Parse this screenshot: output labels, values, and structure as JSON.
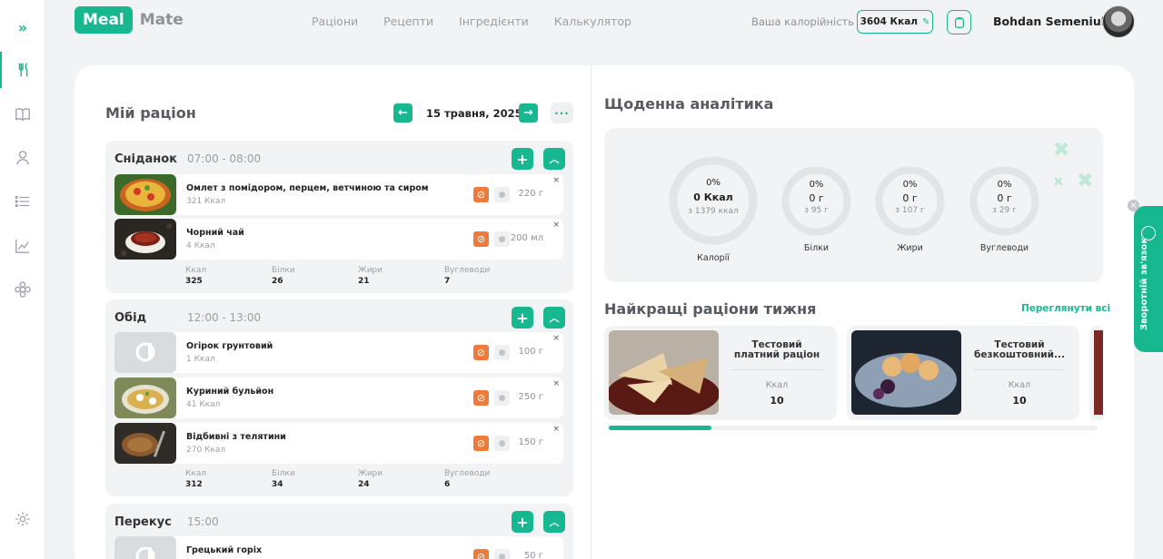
{
  "logo": {
    "part1": "Meal",
    "part2": "Mate"
  },
  "nav": [
    "Раціони",
    "Рецепти",
    "Інгредієнти",
    "Калькулятор"
  ],
  "calories": {
    "label": "Ваша калорійність",
    "value": "3604 Ккал"
  },
  "user": {
    "name": "Bohdan Semeniuk"
  },
  "diet": {
    "title": "Мій раціон",
    "date": "15 травня, 2025",
    "meals": [
      {
        "name": "Сніданок",
        "time": "07:00 - 08:00",
        "items": [
          {
            "name": "Омлет з помідором, перцем, ветчиною та сиром",
            "kcal": "321 Ккал",
            "qty": "220 г"
          },
          {
            "name": "Чорний чай",
            "kcal": "4 Ккал",
            "qty": "200 мл"
          }
        ],
        "totals": {
          "kcal": "325",
          "protein": "26",
          "fat": "21",
          "carbs": "7"
        }
      },
      {
        "name": "Обід",
        "time": "12:00 - 13:00",
        "items": [
          {
            "name": "Огірок грунтовий",
            "kcal": "1 Ккал",
            "qty": "100 г"
          },
          {
            "name": "Куриний бульйон",
            "kcal": "41 Ккал",
            "qty": "250 г"
          },
          {
            "name": "Відбивні з телятини",
            "kcal": "270 Ккал",
            "qty": "150 г"
          }
        ],
        "totals": {
          "kcal": "312",
          "protein": "34",
          "fat": "24",
          "carbs": "6"
        }
      },
      {
        "name": "Перекус",
        "time": "15:00",
        "items": [
          {
            "name": "Грецький горіх",
            "kcal": "",
            "qty": "50 г"
          }
        ]
      }
    ],
    "total_labels": {
      "kcal": "Ккал",
      "protein": "Білки",
      "fat": "Жири",
      "carbs": "Вуглеводи"
    }
  },
  "analytics": {
    "title": "Щоденна аналітика",
    "rings": [
      {
        "pct": "0%",
        "main": "0 Ккал",
        "sub": "з 1379 ккал",
        "label": "Калорії",
        "progress": 0
      },
      {
        "pct": "0%",
        "main": "0 г",
        "sub": "з 95 г",
        "label": "Білки",
        "progress": 0
      },
      {
        "pct": "0%",
        "main": "0 г",
        "sub": "з 107 г",
        "label": "Жири",
        "progress": 0
      },
      {
        "pct": "0%",
        "main": "0 г",
        "sub": "з 29 г",
        "label": "Вуглеводи",
        "progress": 0
      }
    ]
  },
  "weekly": {
    "title": "Найкращі раціони тижня",
    "view_all": "Переглянути всі",
    "cards": [
      {
        "title": "Тестовий платний раціон",
        "kcal_label": "Ккал",
        "kcal_value": "10"
      },
      {
        "title": "Тестовий безкоштовний...",
        "kcal_label": "Ккал",
        "kcal_value": "10"
      }
    ],
    "scroll_progress": 0.21
  },
  "feedback": {
    "label": "Зворотній зв'язок"
  },
  "colors": {
    "accent": "#17b890",
    "block": "#f07a3a"
  }
}
